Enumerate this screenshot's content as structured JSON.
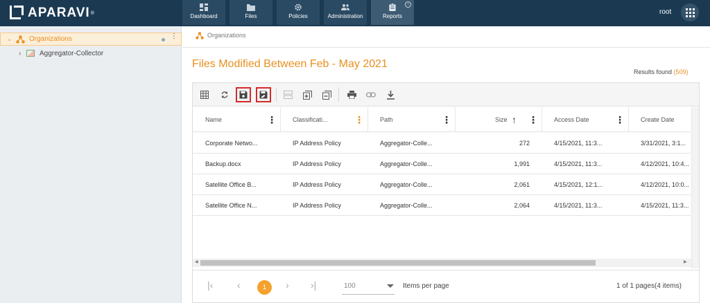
{
  "app": {
    "brand": "APARAVI",
    "trademark": "®",
    "user": "root"
  },
  "nav": [
    {
      "label": "Dashboard",
      "icon": "dashboard-icon"
    },
    {
      "label": "Files",
      "icon": "folder-icon"
    },
    {
      "label": "Policies",
      "icon": "gear-icon"
    },
    {
      "label": "Administration",
      "icon": "users-icon"
    },
    {
      "label": "Reports",
      "icon": "clipboard-icon",
      "active": true,
      "badge": "i"
    }
  ],
  "sidebar": {
    "root": {
      "label": "Organizations",
      "caret": "⌄",
      "kebab": "⋮"
    },
    "children": [
      {
        "label": "Aggregator-Collector",
        "caret": "›"
      }
    ]
  },
  "breadcrumb": "Organizations",
  "report": {
    "title": "Files Modified Between Feb - May 2021",
    "results_label": "Results found",
    "results_count": "(509)"
  },
  "table": {
    "columns": [
      "Name",
      "Classificati...",
      "Path",
      "Size",
      "Access Date",
      "Create Date"
    ],
    "rows": [
      [
        "Corporate Netwo...",
        "IP Address Policy",
        "Aggregator-Colle...",
        "272",
        "4/15/2021, 11:3...",
        "3/31/2021, 3:1..."
      ],
      [
        "Backup.docx",
        "IP Address Policy",
        "Aggregator-Colle...",
        "1,991",
        "4/15/2021, 11:3...",
        "4/12/2021, 10:4..."
      ],
      [
        "Satellite Office B...",
        "IP Address Policy",
        "Aggregator-Colle...",
        "2,061",
        "4/15/2021, 12:1...",
        "4/12/2021, 10:0..."
      ],
      [
        "Satellite Office N...",
        "IP Address Policy",
        "Aggregator-Colle...",
        "2,064",
        "4/15/2021, 11:3...",
        "4/15/2021, 11:3..."
      ]
    ]
  },
  "pager": {
    "current_page": "1",
    "per_page_value": "100",
    "per_page_label": "Items per page",
    "info": "1 of 1 pages(4 items)"
  },
  "colors": {
    "brand_orange": "#e7901f",
    "topbar": "#1b3a52",
    "highlight": "#d42a2a"
  }
}
